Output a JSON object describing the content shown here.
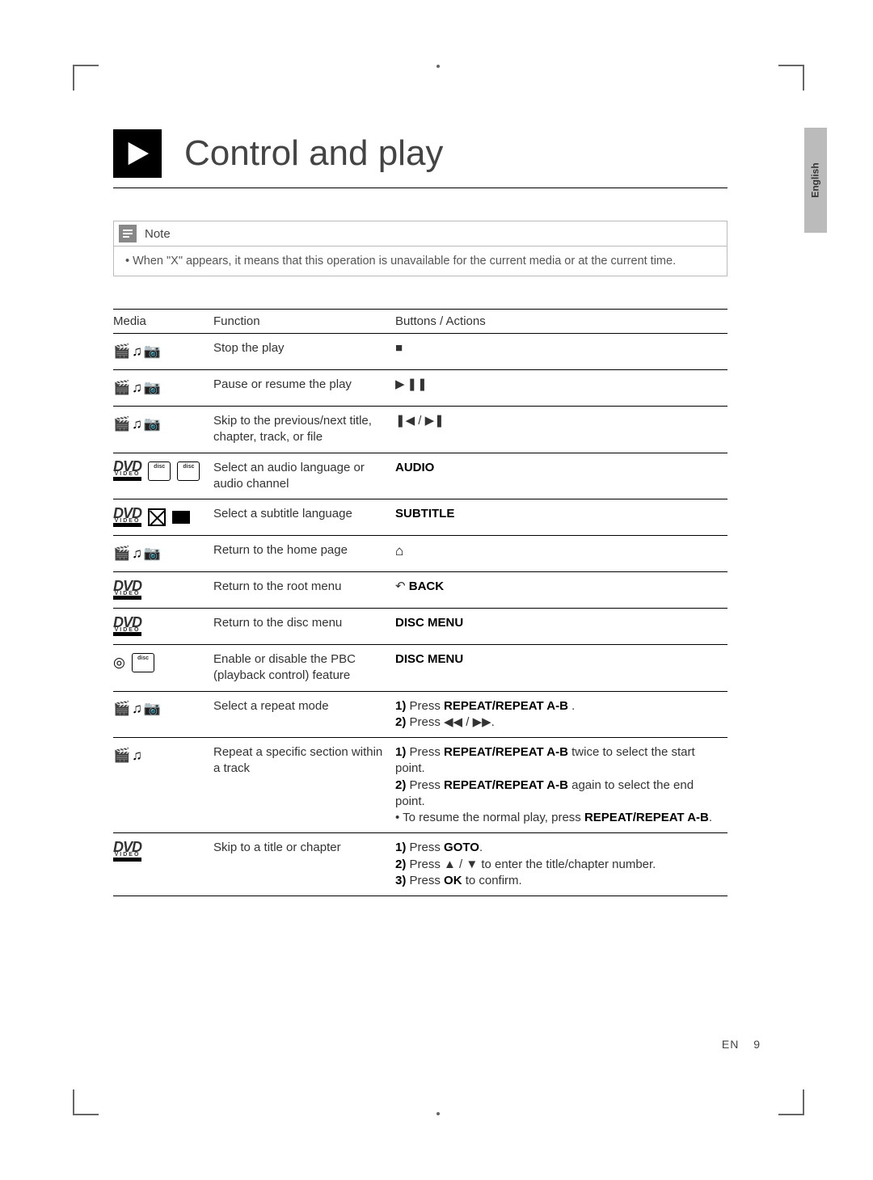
{
  "language_tab": "English",
  "heading": "Control and play",
  "note": {
    "label": "Note",
    "text": "When \"X\" appears, it means that this operation is unavailable for the current media or at the current time."
  },
  "table": {
    "head": {
      "media": "Media",
      "function": "Function",
      "actions": "Buttons / Actions"
    },
    "rows": [
      {
        "function": "Stop the play",
        "actions_html": "■"
      },
      {
        "function": "Pause or resume the play",
        "actions_html": "▶ ❚❚"
      },
      {
        "function": "Skip to the previous/next title, chapter, track, or file",
        "actions_html": "❚◀ / ▶❚"
      },
      {
        "function": "Select an audio language or audio channel",
        "actions_html": "<b>AUDIO</b>"
      },
      {
        "function": "Select a subtitle language",
        "actions_html": "<b>SUBTITLE</b>"
      },
      {
        "function": "Return to the home page",
        "actions_html": "<span class='home-icon'>⌂</span>"
      },
      {
        "function": "Return to the root menu",
        "actions_html": "↶ <b>BACK</b>"
      },
      {
        "function": "Return to the disc menu",
        "actions_html": "<b>DISC MENU</b>"
      },
      {
        "function": "Enable or disable the PBC (playback control) feature",
        "actions_html": "<b>DISC MENU</b>"
      },
      {
        "function": "Select a repeat mode",
        "actions_html": "<b>1)</b> Press <b>REPEAT/REPEAT A-B</b> .<br><b>2)</b> Press ◀◀ / ▶▶."
      },
      {
        "function": "Repeat a specific section within a track",
        "actions_html": "<b>1)</b> Press <b>REPEAT/REPEAT A-B</b>  twice to select the start point.<br><b>2)</b> Press <b>REPEAT/REPEAT A-B</b> again to select the end point.<br>•  To resume the normal play, press <b>REPEAT/REPEAT A-B</b>."
      },
      {
        "function": "Skip to a title or chapter",
        "actions_html": "<b>1)</b> Press <b>GOTO</b>.<br><b>2)</b> Press ▲ / ▼ to enter the title/chapter number.<br><b>3)</b> Press <b>OK</b> to confirm."
      }
    ]
  },
  "footer": {
    "lang": "EN",
    "page": "9"
  }
}
